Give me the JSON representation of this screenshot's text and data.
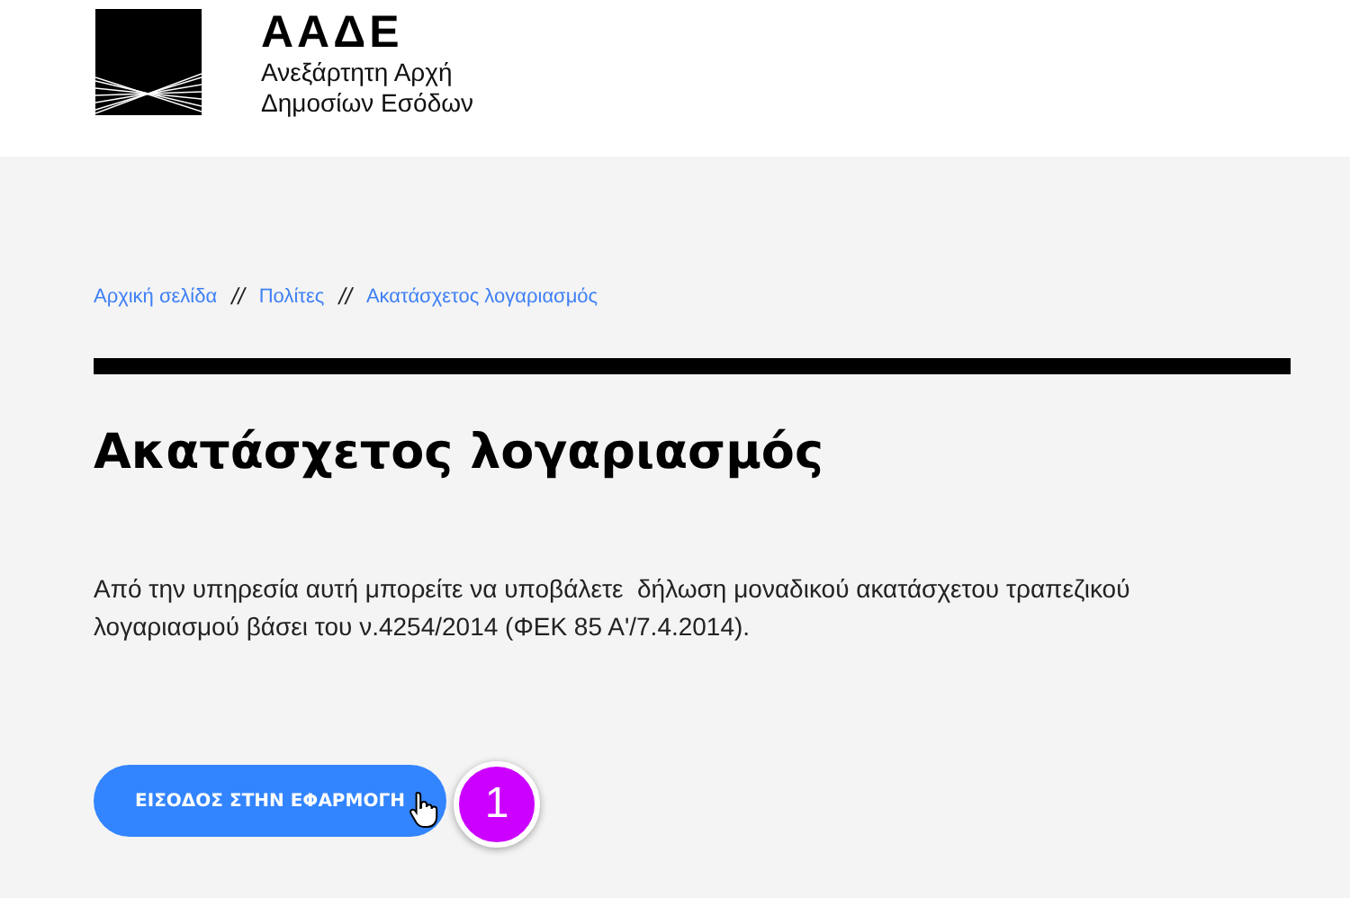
{
  "header": {
    "logo_title": "ΑΑΔΕ",
    "logo_subtitle_lines": [
      "Ανεξάρτητη Αρχή",
      "Δημοσίων Εσόδων"
    ]
  },
  "breadcrumb": [
    {
      "label": "Αρχική σελίδα"
    },
    {
      "label": "Πολίτες"
    },
    {
      "label": "Ακατάσχετος λογαριασμός"
    }
  ],
  "breadcrumb_separator": "//",
  "title": "Ακατάσχετος λογαριασμός",
  "description": "Από την υπηρεσία αυτή μπορείτε να υποβάλετε  δήλωση μοναδικού ακατάσχετου τραπεζικού λογαριασμού βάσει του ν.4254/2014 (ΦΕΚ 85 Α'/7.4.2014).",
  "button": {
    "label": "ΕΙΣΟΔΟΣ ΣΤΗΝ ΕΦΑΡΜΟΓΗ"
  },
  "step_badge": {
    "label": "1",
    "color": "#cc00ff"
  }
}
